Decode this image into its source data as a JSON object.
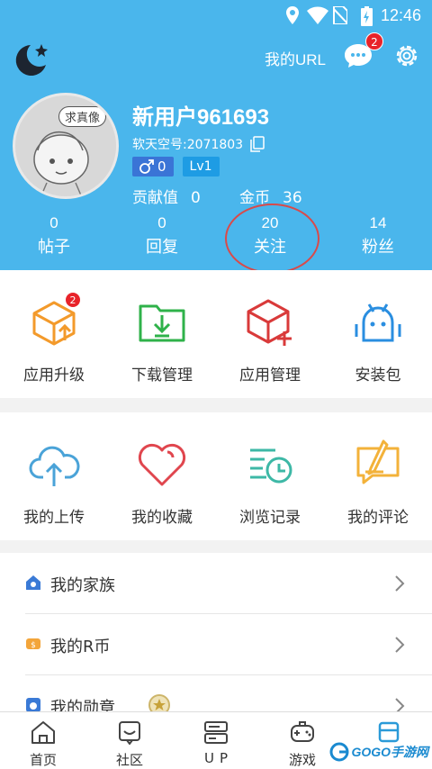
{
  "status": {
    "time": "12:46"
  },
  "header": {
    "my_url": "我的URL",
    "message_badge": "2"
  },
  "profile": {
    "avatar_bubble": "求真像",
    "username": "新用户961693",
    "uid": "软天空号:2071803",
    "gender_count": "0",
    "level": "Lv1",
    "contribution_label": "贡献值",
    "contribution_value": "0",
    "coins_label": "金币",
    "coins_value": "36"
  },
  "counts": [
    {
      "value": "0",
      "label": "帖子"
    },
    {
      "value": "0",
      "label": "回复"
    },
    {
      "value": "20",
      "label": "关注"
    },
    {
      "value": "14",
      "label": "粉丝"
    }
  ],
  "grid1": [
    {
      "label": "应用升级",
      "icon": "app-upgrade-icon",
      "badge": "2"
    },
    {
      "label": "下载管理",
      "icon": "download-manager-icon"
    },
    {
      "label": "应用管理",
      "icon": "app-manager-icon"
    },
    {
      "label": "安装包",
      "icon": "android-package-icon"
    }
  ],
  "grid2": [
    {
      "label": "我的上传",
      "icon": "cloud-upload-icon"
    },
    {
      "label": "我的收藏",
      "icon": "heart-icon"
    },
    {
      "label": "浏览记录",
      "icon": "history-icon"
    },
    {
      "label": "我的评论",
      "icon": "comment-edit-icon"
    }
  ],
  "list": [
    {
      "label": "我的家族",
      "icon": "family-icon"
    },
    {
      "label": "我的R币",
      "icon": "coin-icon"
    },
    {
      "label": "我的勋章",
      "icon": "medal-icon"
    }
  ],
  "tabs": [
    {
      "label": "首页",
      "icon": "home-icon"
    },
    {
      "label": "社区",
      "icon": "community-icon"
    },
    {
      "label": "UP",
      "icon": "up-icon"
    },
    {
      "label": "游戏",
      "icon": "game-icon"
    },
    {
      "label": "",
      "icon": "me-icon"
    }
  ],
  "watermark": {
    "text": "GOGO手游网"
  },
  "colors": {
    "header": "#4ab6ec",
    "badge": "#e8232a",
    "highlight": "#d94a4a"
  }
}
